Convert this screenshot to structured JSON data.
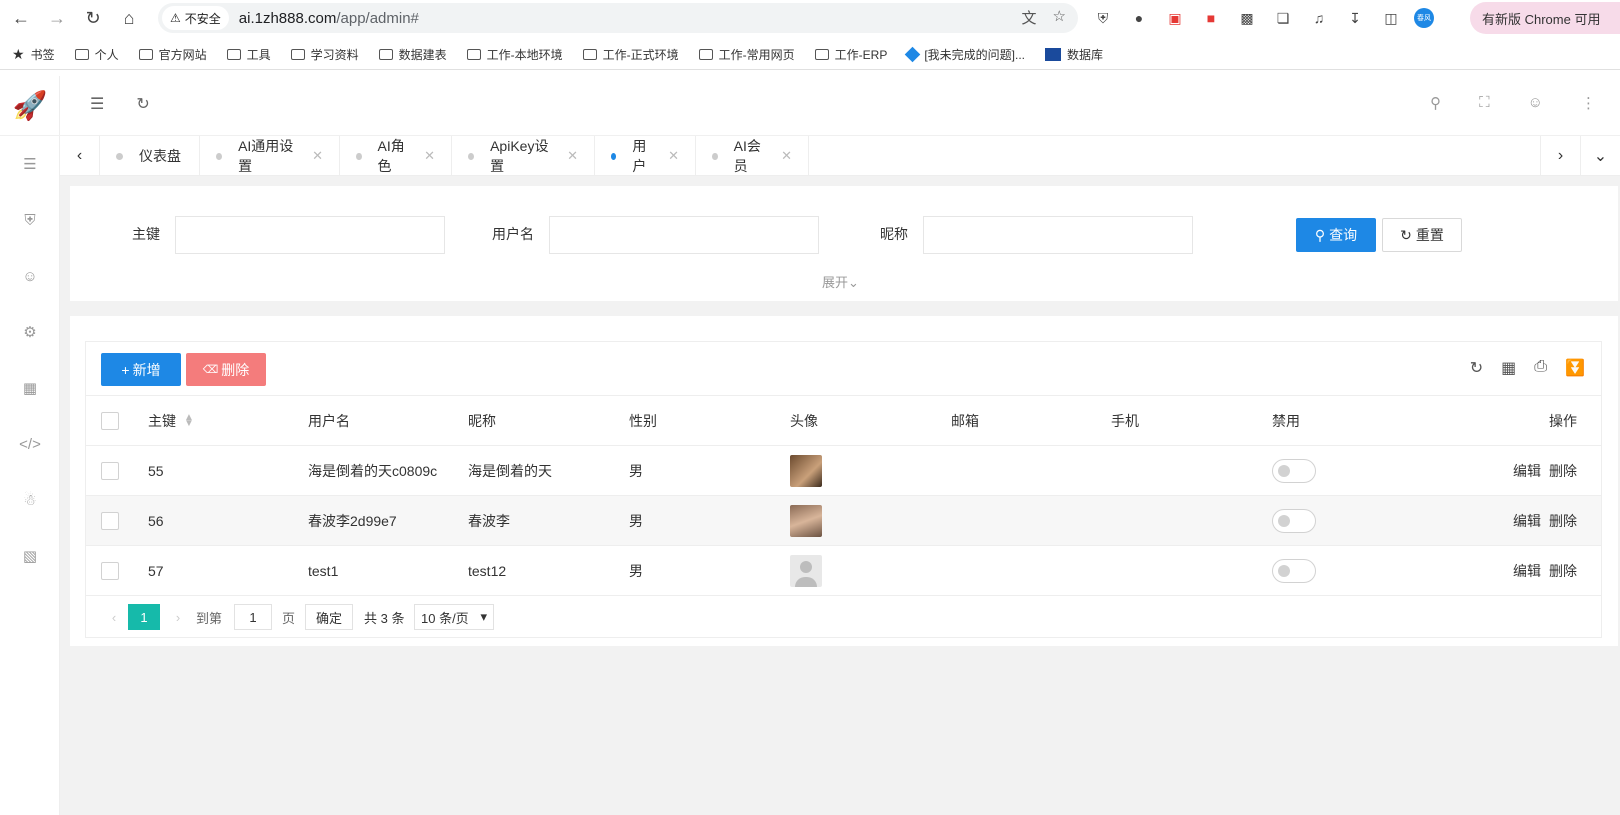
{
  "browser": {
    "insecure_label": "不安全",
    "url_host": "ai.1zh888.com",
    "url_path": "/app/admin#",
    "profile_badge": "春风",
    "update_label": "有新版 Chrome 可用"
  },
  "bookmarks": [
    {
      "label": "书签",
      "type": "star"
    },
    {
      "label": "个人",
      "type": "folder"
    },
    {
      "label": "官方网站",
      "type": "folder"
    },
    {
      "label": "工具",
      "type": "folder"
    },
    {
      "label": "学习资料",
      "type": "folder"
    },
    {
      "label": "数据建表",
      "type": "folder"
    },
    {
      "label": "工作-本地环境",
      "type": "folder"
    },
    {
      "label": "工作-正式环境",
      "type": "folder"
    },
    {
      "label": "工作-常用网页",
      "type": "folder"
    },
    {
      "label": "工作-ERP",
      "type": "folder"
    },
    {
      "label": "[我未完成的问题]...",
      "type": "diamond"
    },
    {
      "label": "数据库",
      "type": "db"
    }
  ],
  "tabs": [
    {
      "label": "仪表盘",
      "closable": false,
      "active": false
    },
    {
      "label": "AI通用设置",
      "closable": true,
      "active": false
    },
    {
      "label": "AI角色",
      "closable": true,
      "active": false
    },
    {
      "label": "ApiKey设置",
      "closable": true,
      "active": false
    },
    {
      "label": "用户",
      "closable": true,
      "active": true
    },
    {
      "label": "AI会员",
      "closable": true,
      "active": false
    }
  ],
  "search": {
    "labels": {
      "id": "主键",
      "username": "用户名",
      "nickname": "昵称"
    },
    "query_label": "查询",
    "reset_label": "重置",
    "expand_label": "展开"
  },
  "toolbar": {
    "add_label": "新增",
    "delete_label": "删除"
  },
  "table": {
    "headers": [
      "主键",
      "用户名",
      "昵称",
      "性别",
      "头像",
      "邮箱",
      "手机",
      "禁用",
      "操作"
    ],
    "rows": [
      {
        "id": "55",
        "username": "海是倒着的天c0809c",
        "nickname": "海是倒着的天",
        "gender": "男",
        "email": "",
        "phone": "",
        "edit": "编辑",
        "delete": "删除"
      },
      {
        "id": "56",
        "username": "春波李2d99e7",
        "nickname": "春波李",
        "gender": "男",
        "email": "",
        "phone": "",
        "edit": "编辑",
        "delete": "删除"
      },
      {
        "id": "57",
        "username": "test1",
        "nickname": "test12",
        "gender": "男",
        "email": "",
        "phone": "",
        "edit": "编辑",
        "delete": "删除"
      }
    ]
  },
  "pager": {
    "current": "1",
    "goto_label": "到第",
    "goto_value": "1",
    "page_suffix": "页",
    "confirm_label": "确定",
    "total_label": "共 3 条",
    "page_size": "10 条/页"
  },
  "colors": {
    "primary": "#1e88e5",
    "danger": "#f47c7c",
    "pager_active": "#16baaa"
  }
}
